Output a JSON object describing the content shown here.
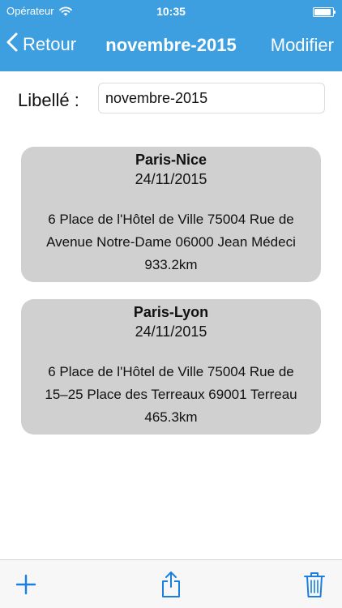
{
  "status_bar": {
    "carrier": "Opérateur",
    "time": "10:35",
    "battery_level": 1.0
  },
  "navbar": {
    "back_label": "Retour",
    "title": "novembre-2015",
    "edit_label": "Modifier"
  },
  "form": {
    "label": "Libellé :",
    "value": "novembre-2015"
  },
  "trips": [
    {
      "title": "Paris-Nice",
      "date": "24/11/2015",
      "from": "6 Place de l'Hôtel de Ville 75004 Rue de",
      "to": "Avenue Notre-Dame 06000 Jean Médeci",
      "distance": "933.2km"
    },
    {
      "title": "Paris-Lyon",
      "date": "24/11/2015",
      "from": "6 Place de l'Hôtel de Ville 75004 Rue de",
      "to": "15–25 Place des Terreaux 69001 Terreau",
      "distance": "465.3km"
    }
  ],
  "toolbar": {
    "add_icon": "plus-icon",
    "share_icon": "share-icon",
    "trash_icon": "trash-icon"
  },
  "colors": {
    "accent": "#3d9fe0",
    "card_background": "#d0d0d0",
    "toolbar_tint": "#1a7fe0"
  }
}
